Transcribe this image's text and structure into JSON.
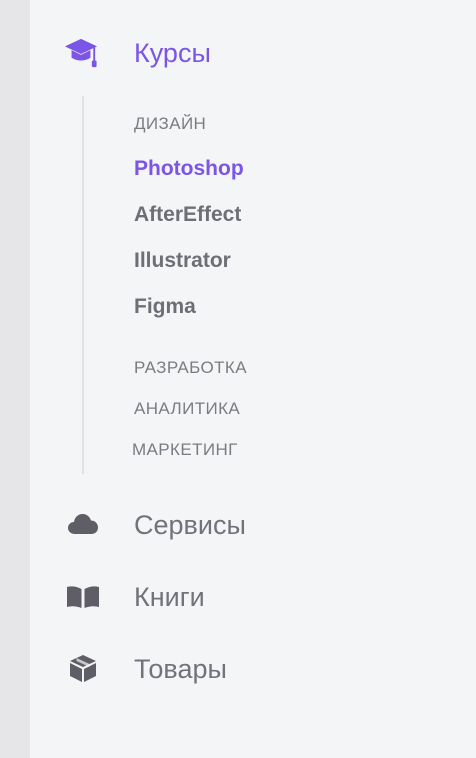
{
  "colors": {
    "accent": "#7a55e6",
    "text": "#6f6e77",
    "icon": "#5f5e66",
    "panel_bg": "#f4f5f7",
    "left_strip": "#e6e6e8"
  },
  "nav": {
    "courses": {
      "label": "Курсы",
      "icon": "graduation-cap-icon",
      "active": true,
      "groups": {
        "design": {
          "label": "ДИЗАЙН",
          "items": [
            "Photoshop",
            "AfterEffect",
            "Illustrator",
            "Figma"
          ],
          "active_item": "Photoshop"
        },
        "development": {
          "label": "РАЗРАБОТКА"
        },
        "analytics": {
          "label": "АНАЛИТИКА"
        },
        "marketing": {
          "label": "МАРКЕТИНГ"
        }
      }
    },
    "services": {
      "label": "Сервисы",
      "icon": "cloud-icon"
    },
    "books": {
      "label": "Книги",
      "icon": "open-book-icon"
    },
    "goods": {
      "label": "Товары",
      "icon": "box-icon"
    }
  }
}
